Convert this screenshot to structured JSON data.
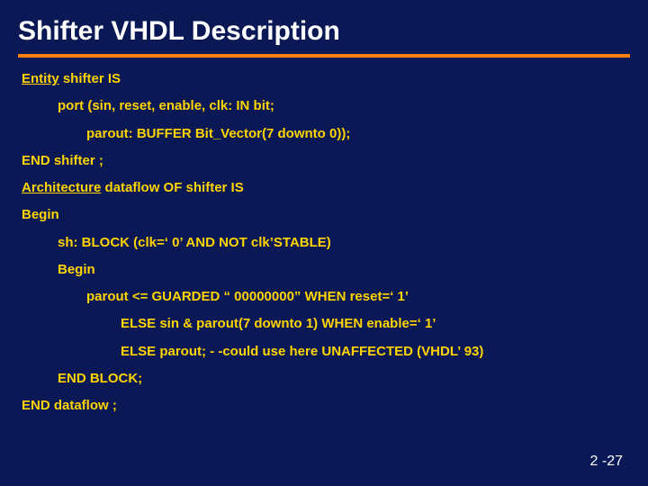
{
  "title": "Shifter VHDL Description",
  "lines": {
    "l1a": "Entity",
    "l1b": " shifter IS",
    "l2": "port (sin, reset, enable, clk: IN bit;",
    "l3": "parout: BUFFER Bit_Vector(7 downto 0));",
    "l4": "END shifter ;",
    "l5a": "Architecture",
    "l5b": " dataflow OF shifter IS",
    "l6": "Begin",
    "l7": "sh: BLOCK (clk=‘ 0’ AND NOT clk’STABLE)",
    "l8": "Begin",
    "l9": "parout <= GUARDED “ 00000000” WHEN reset=‘ 1’",
    "l10": "ELSE sin & parout(7 downto 1) WHEN enable=‘ 1’",
    "l11": "ELSE parout; - -could use here UNAFFECTED (VHDL’ 93)",
    "l12": "END BLOCK;",
    "l13": "END dataflow ;"
  },
  "pagenum": "2 -27"
}
